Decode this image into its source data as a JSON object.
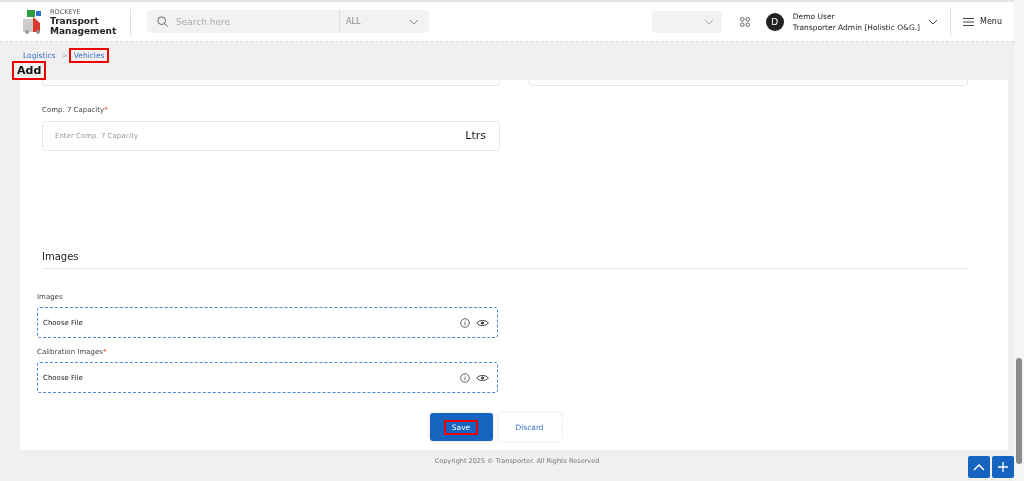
{
  "header": {
    "brand_top": "ROCKEYE",
    "brand_name": "Transport Management",
    "search": {
      "placeholder": "Search here",
      "filter": "ALL"
    },
    "user": {
      "initial": "D",
      "name": "Demo User",
      "role": "Transporter Admin [Holistic O&G.]"
    },
    "menu": "Menu"
  },
  "breadcrumb": [
    {
      "label": "Logistics",
      "highlighted": false
    },
    {
      "label": "Vehicles",
      "highlighted": true
    }
  ],
  "breadcrumb_separator": ">",
  "page_title": {
    "text": "Add",
    "highlighted": true
  },
  "capacity_field": {
    "label": "Comp. 7 Capacity",
    "required_mark": "*",
    "placeholder": "Enter Comp. 7 Capacity",
    "unit": "Ltrs"
  },
  "section_title": "Images",
  "file_fields": [
    {
      "label": "Images",
      "button": "Choose File"
    },
    {
      "label": "Calibration Images",
      "required_mark": "*",
      "button": "Choose File"
    }
  ],
  "actions": [
    {
      "label": "Save",
      "kind": "primary",
      "highlighted": true
    },
    {
      "label": "Discard",
      "kind": "secondary",
      "highlighted": false
    }
  ],
  "footer": "Copyright 2025 © Transporter. All Rights Reserved"
}
